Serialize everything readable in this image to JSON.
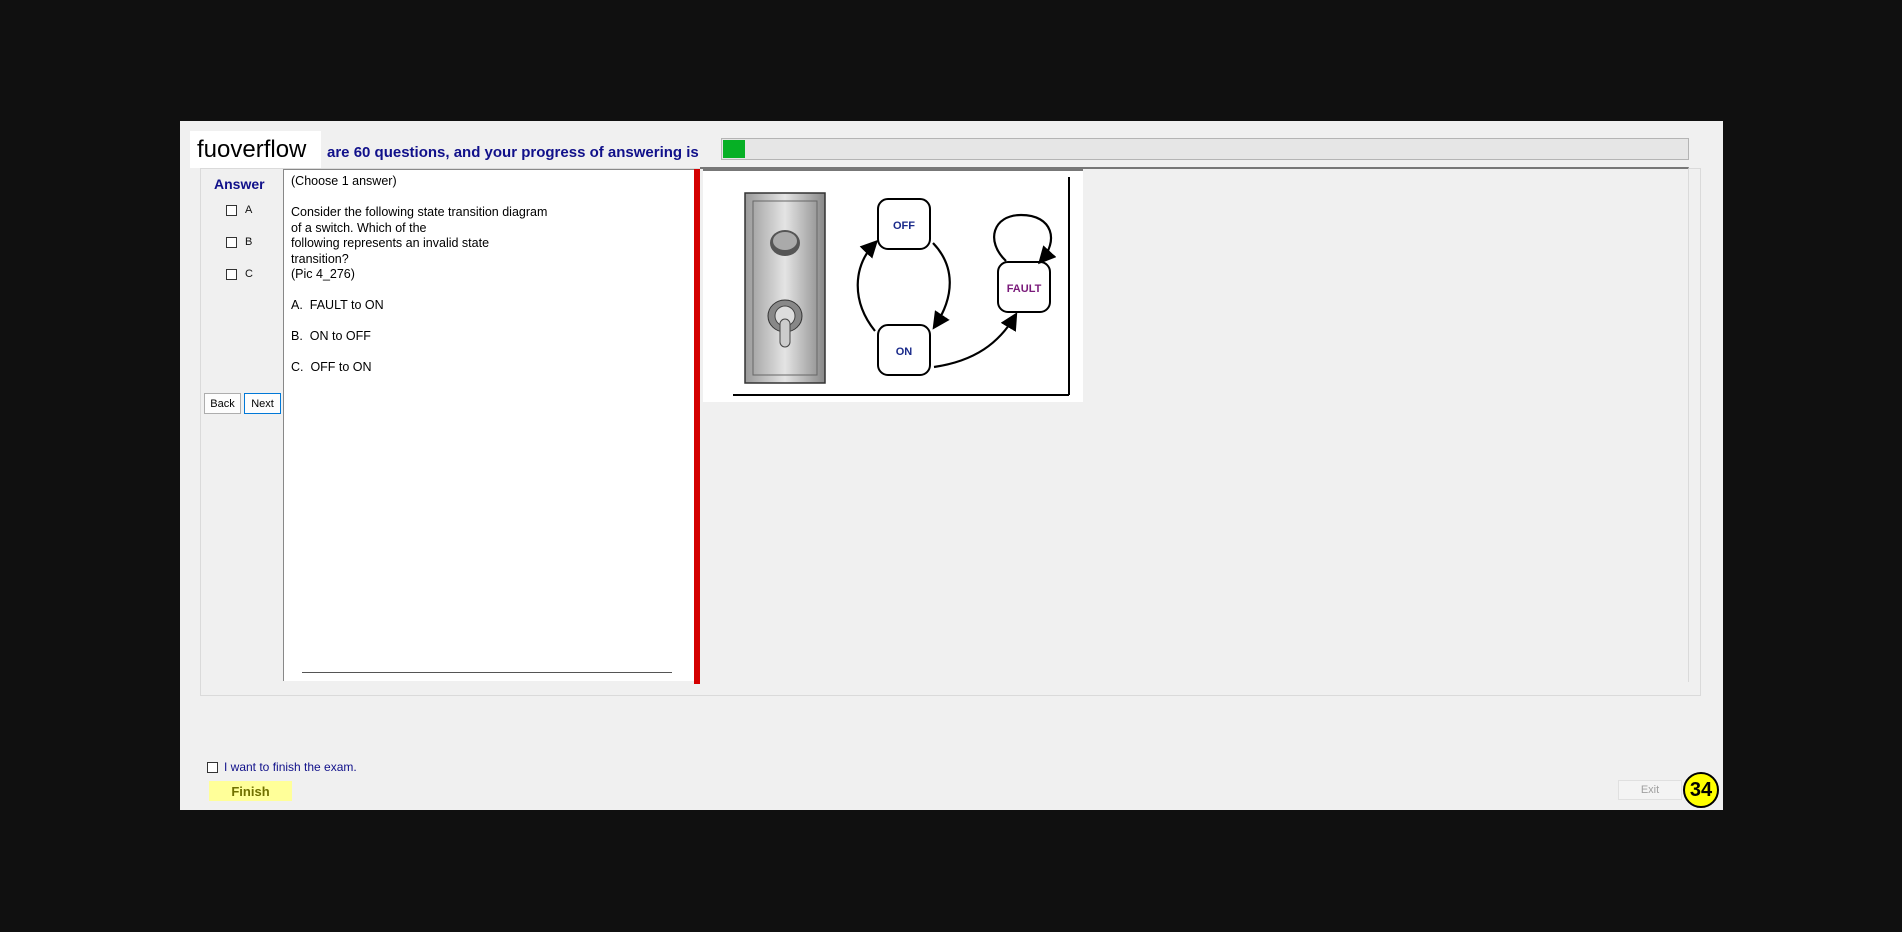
{
  "brand": {
    "text": "fuoverflow"
  },
  "progress": {
    "text": "are 60 questions, and your progress of answering is",
    "fraction": 0.023,
    "fill_color": "#06b025"
  },
  "answer": {
    "header": "Answer",
    "options": [
      "A",
      "B",
      "C"
    ]
  },
  "nav": {
    "back": "Back",
    "next": "Next"
  },
  "question": {
    "text": "(Choose 1 answer)\n\nConsider the following state transition diagram\nof a switch. Which of the\nfollowing represents an invalid state\ntransition?\n(Pic 4_276)\n\nA.  FAULT to ON\n\nB.  ON to OFF\n\nC.  OFF to ON"
  },
  "diagram": {
    "states": {
      "off": "OFF",
      "on": "ON",
      "fault": "FAULT"
    }
  },
  "footer": {
    "finish_check_label": "I want to finish the exam.",
    "finish_button": "Finish",
    "exit_button": "Exit",
    "count": "34"
  }
}
